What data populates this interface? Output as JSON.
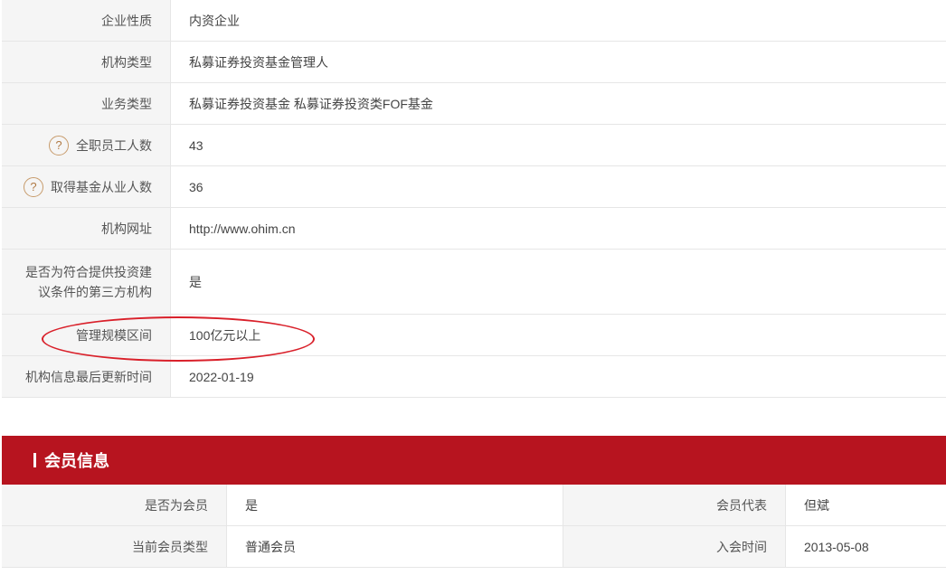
{
  "org_info": {
    "rows": [
      {
        "label": "企业性质",
        "value": "内资企业"
      },
      {
        "label": "机构类型",
        "value": "私募证券投资基金管理人"
      },
      {
        "label": "业务类型",
        "value": "私募证券投资基金  私募证券投资类FOF基金"
      },
      {
        "label": "全职员工人数",
        "value": "43"
      },
      {
        "label": "取得基金从业人数",
        "value": "36"
      },
      {
        "label": "机构网址",
        "value": "http://www.ohim.cn"
      },
      {
        "label_line1": "是否为符合提供投资建",
        "label_line2": "议条件的第三方机构",
        "value": "是"
      },
      {
        "label": "管理规模区间",
        "value": "100亿元以上"
      },
      {
        "label": "机构信息最后更新时间",
        "value": "2022-01-19"
      }
    ],
    "help_icon_glyph": "?"
  },
  "member_section": {
    "title": "会员信息",
    "rows": [
      {
        "label1": "是否为会员",
        "value1": "是",
        "label2": "会员代表",
        "value2": "但斌"
      },
      {
        "label1": "当前会员类型",
        "value1": "普通会员",
        "label2": "入会时间",
        "value2": "2013-05-08"
      }
    ]
  },
  "colors": {
    "header_red": "#b7141f",
    "highlight_red": "#d9202a",
    "label_bg": "#f5f5f5",
    "help_icon": "#c79b6b"
  }
}
